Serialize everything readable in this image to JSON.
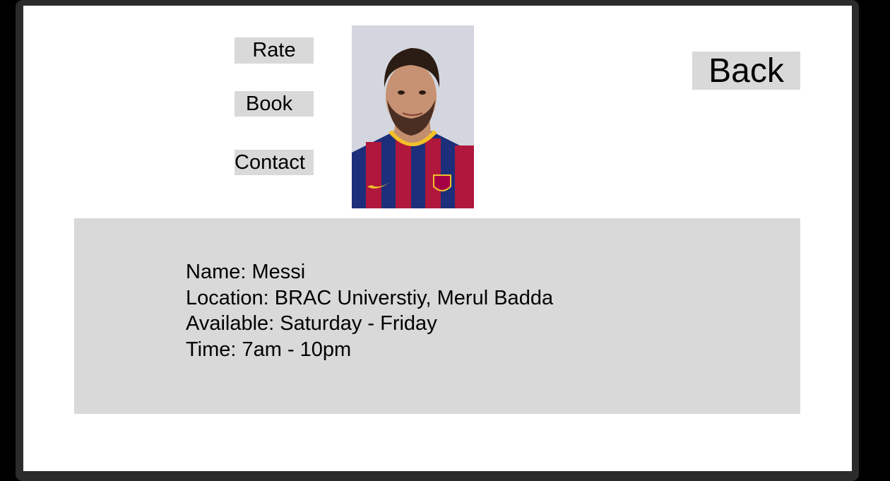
{
  "actions": {
    "rate_label": "Rate",
    "book_label": "Book",
    "contact_label": "Contact",
    "back_label": "Back"
  },
  "profile": {
    "photo_icon": "player-portrait-photo",
    "name_line": "Name: Messi",
    "location_line": "Location: BRAC Universtiy, Merul Badda",
    "available_line": "Available: Saturday - Friday",
    "time_line": "Time: 7am - 10pm"
  },
  "colors": {
    "button_bg": "#d9d9d9",
    "panel_bg": "#d9d9d9",
    "screen_bg": "#ffffff",
    "bezel": "#2b2b2b"
  }
}
